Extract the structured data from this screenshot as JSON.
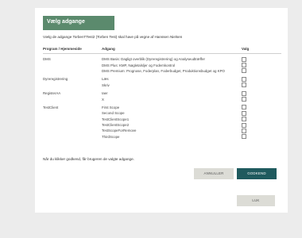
{
  "dialog": {
    "title": "Vælg adgange",
    "intro": "Vælg de adgange TorbenTTest2 (Torben Test) skal have på vegne af Hanssen Nielsen",
    "columns": {
      "program": "Program / Hjemmeside",
      "adgang": "Adgang",
      "valg": "Valg"
    },
    "groups": [
      {
        "program": "DMS",
        "items": [
          {
            "label": "DMS Basis: Dagligt overblik (Dyreregistrering) og Analyseudtræffer",
            "checked": false
          },
          {
            "label": "DMS Plus: KMP, Nøgletalsljer og Fodernkontrol",
            "checked": false
          },
          {
            "label": "DMS Premium: Prognose, Foderplan, Foderbudget, Produktionsbudget og KPO",
            "checked": false
          }
        ]
      },
      {
        "program": "Dyreregistrering",
        "items": [
          {
            "label": "Læs",
            "checked": false
          },
          {
            "label": "Skriv",
            "checked": false
          }
        ]
      },
      {
        "program": "RegisterAA",
        "items": [
          {
            "label": "Iaer",
            "checked": false
          },
          {
            "label": "X",
            "checked": false
          }
        ]
      },
      {
        "program": "TestClient",
        "items": [
          {
            "label": "First Scope",
            "checked": false
          },
          {
            "label": "Second Scope",
            "checked": false
          },
          {
            "label": "TestClientScope1",
            "checked": false
          },
          {
            "label": "TestClientScope2",
            "checked": false
          },
          {
            "label": "TestScopeForRemove",
            "checked": false
          },
          {
            "label": "ThirdScope",
            "checked": false
          }
        ]
      }
    ],
    "footnote": "Når du klikker godkend, får brugeren de valgte adgange.",
    "buttons": {
      "cancel": "ANNULLER",
      "approve": "GODKEND",
      "close": "LUK"
    }
  },
  "colors": {
    "accent": "#5b8a6d",
    "primary_button": "#1f5a5e",
    "secondary_button": "#dcdcd6",
    "background": "#ececec"
  }
}
